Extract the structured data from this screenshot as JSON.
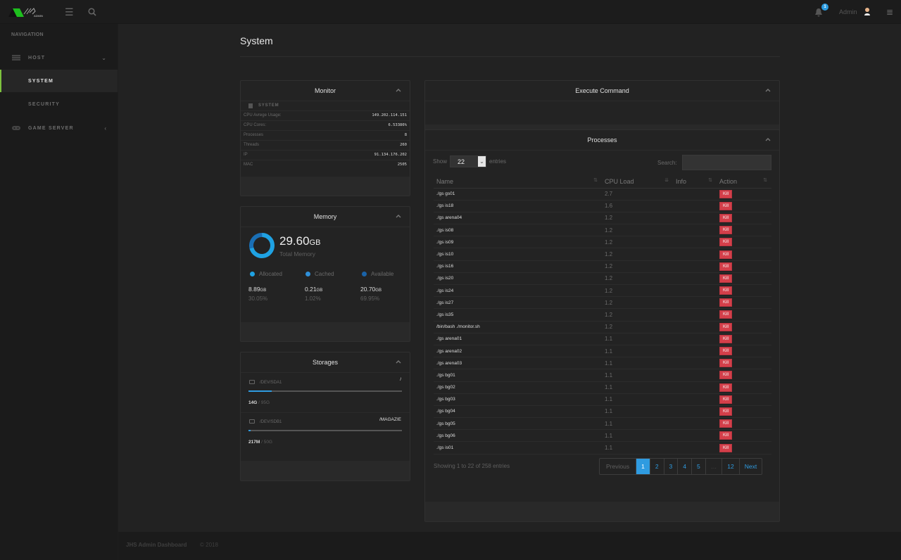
{
  "topbar": {
    "logo_text": "ADMIN",
    "notification_count": "1",
    "user_name": "Admin"
  },
  "sidebar": {
    "heading": "NAVIGATION",
    "items": [
      {
        "label": "HOST",
        "icon": "server-icon",
        "chevron": "expanded"
      },
      {
        "label": "SYSTEM",
        "active": true
      },
      {
        "label": "SECURITY"
      },
      {
        "label": "GAME SERVER",
        "icon": "gamepad-icon",
        "chevron": "collapsed"
      }
    ]
  },
  "page": {
    "title": "System"
  },
  "monitor": {
    "title": "Monitor",
    "section": "SYSTEM",
    "rows": [
      {
        "key": "CPU Avrege Usage:",
        "value": "149.202.114.151"
      },
      {
        "key": "CPU Cores:",
        "value": "6.53386%"
      },
      {
        "key": "Processes",
        "value": "8"
      },
      {
        "key": "Threads",
        "value": "260"
      },
      {
        "key": "IP",
        "value": "91.134.176.202"
      },
      {
        "key": "MAC",
        "value": "2505"
      }
    ]
  },
  "memory": {
    "title": "Memory",
    "total_value": "29.60",
    "total_unit": "GB",
    "total_label": "Total Memory",
    "colors": {
      "allocated": "#1fa2e3",
      "cached": "#2f8fd8",
      "available": "#1a63a8"
    },
    "legend": [
      {
        "label": "Allocated",
        "value": "8.89",
        "unit": "GB",
        "percent": "30.05%"
      },
      {
        "label": "Cached",
        "value": "0.21",
        "unit": "GB",
        "percent": "1.02%"
      },
      {
        "label": "Available",
        "value": "20.70",
        "unit": "GB",
        "percent": "69.95%"
      }
    ]
  },
  "storages": {
    "title": "Storages",
    "items": [
      {
        "device": "/DEV/SDA1",
        "mount": "/",
        "used": "14G",
        "total": "95G",
        "used_fraction": 0.15
      },
      {
        "device": "/DEV/SDB1",
        "mount": "/MAGAZIE",
        "used": "217M",
        "total": "50G",
        "used_fraction": 0.01
      }
    ]
  },
  "execute": {
    "title": "Execute Command"
  },
  "processes": {
    "title": "Processes",
    "show_label": "Show",
    "entries_label": "entries",
    "page_size": "22",
    "search_label": "Search:",
    "search_value": "",
    "columns": [
      "Name",
      "CPU Load",
      "Info",
      "Action"
    ],
    "action_label": "Kill",
    "rows": [
      {
        "name": "./gs gs01",
        "cpu": "2.7"
      },
      {
        "name": "./gs is18",
        "cpu": "1.6"
      },
      {
        "name": "./gs arena04",
        "cpu": "1.2"
      },
      {
        "name": "./gs is08",
        "cpu": "1.2"
      },
      {
        "name": "./gs is09",
        "cpu": "1.2"
      },
      {
        "name": "./gs is10",
        "cpu": "1.2"
      },
      {
        "name": "./gs is16",
        "cpu": "1.2"
      },
      {
        "name": "./gs is20",
        "cpu": "1.2"
      },
      {
        "name": "./gs is24",
        "cpu": "1.2"
      },
      {
        "name": "./gs is27",
        "cpu": "1.2"
      },
      {
        "name": "./gs is35",
        "cpu": "1.2"
      },
      {
        "name": "/bin/bash ./monitor.sh",
        "cpu": "1.2"
      },
      {
        "name": "./gs arena01",
        "cpu": "1.1"
      },
      {
        "name": "./gs arena02",
        "cpu": "1.1"
      },
      {
        "name": "./gs arena03",
        "cpu": "1.1"
      },
      {
        "name": "./gs bg01",
        "cpu": "1.1"
      },
      {
        "name": "./gs bg02",
        "cpu": "1.1"
      },
      {
        "name": "./gs bg03",
        "cpu": "1.1"
      },
      {
        "name": "./gs bg04",
        "cpu": "1.1"
      },
      {
        "name": "./gs bg05",
        "cpu": "1.1"
      },
      {
        "name": "./gs bg06",
        "cpu": "1.1"
      },
      {
        "name": "./gs is01",
        "cpu": "1.1"
      }
    ],
    "info": "Showing 1 to 22 of 258 entries",
    "pagination": [
      "Previous",
      "1",
      "2",
      "3",
      "4",
      "5",
      "…",
      "12",
      "Next"
    ],
    "current_page": "1"
  },
  "footer": {
    "title": "JHS Admin Dashboard",
    "copyright": "© 2018"
  }
}
